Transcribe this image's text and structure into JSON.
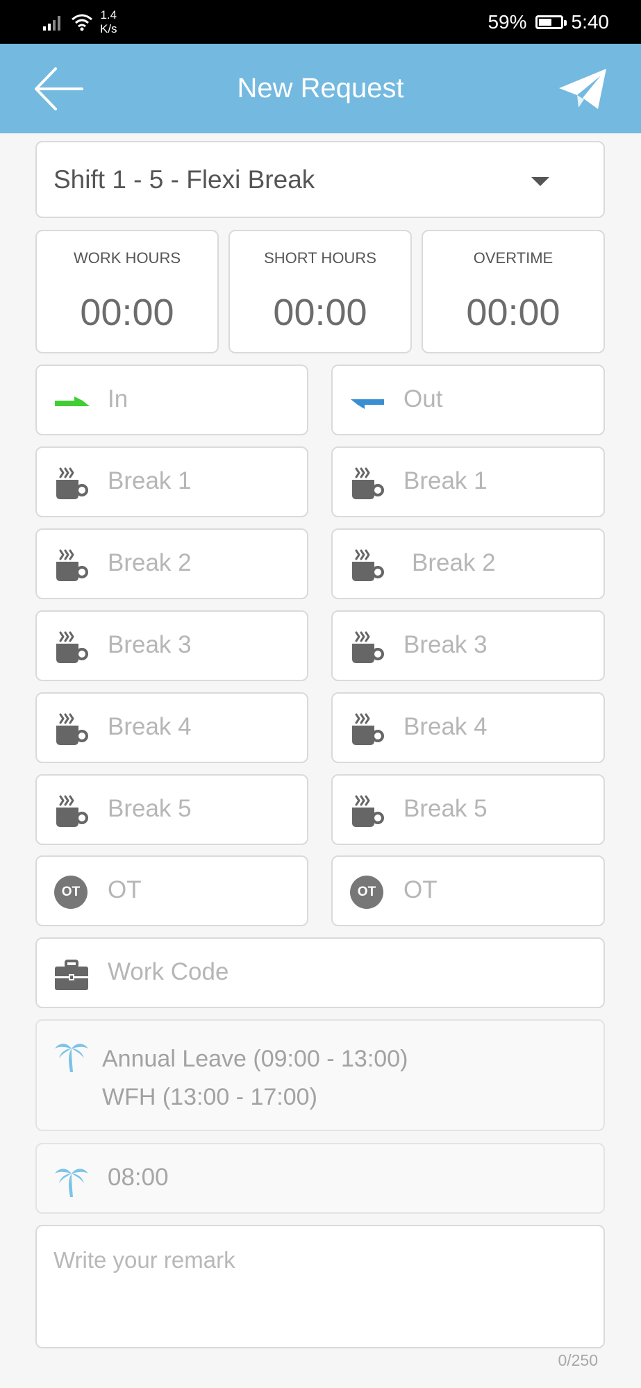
{
  "status_bar": {
    "net_speed": "1.4",
    "net_unit": "K/s",
    "battery_percent": "59%",
    "battery_level": 0.59,
    "time": "5:40",
    "icons": [
      "signal-icon",
      "wifi-icon",
      "battery-icon"
    ]
  },
  "app_bar": {
    "title": "New Request",
    "background": "#74b9df",
    "left_icon": "back-arrow-icon",
    "right_icon": "send-icon"
  },
  "shift_select": {
    "value": "Shift 1 - 5 - Flexi Break",
    "icon": "dropdown-caret-icon"
  },
  "stats": [
    {
      "label": "WORK HOURS",
      "value": "00:00"
    },
    {
      "label": "SHORT HOURS",
      "value": "00:00"
    },
    {
      "label": "OVERTIME",
      "value": "00:00"
    }
  ],
  "time_rows": [
    {
      "left": {
        "placeholder": "In",
        "icon": "clock-in-arrow-icon",
        "icon_color": "#3fcf33"
      },
      "right": {
        "placeholder": "Out",
        "icon": "clock-out-arrow-icon",
        "icon_color": "#3a8fd2"
      }
    },
    {
      "left": {
        "placeholder": "Break 1",
        "icon": "coffee-cup-icon"
      },
      "right": {
        "placeholder": "Break 1",
        "icon": "coffee-cup-icon"
      }
    },
    {
      "left": {
        "placeholder": "Break 2",
        "icon": "coffee-cup-icon"
      },
      "right": {
        "placeholder": "Break 2",
        "icon": "coffee-cup-icon"
      }
    },
    {
      "left": {
        "placeholder": "Break 3",
        "icon": "coffee-cup-icon"
      },
      "right": {
        "placeholder": "Break 3",
        "icon": "coffee-cup-icon"
      }
    },
    {
      "left": {
        "placeholder": "Break 4",
        "icon": "coffee-cup-icon"
      },
      "right": {
        "placeholder": "Break 4",
        "icon": "coffee-cup-icon"
      }
    },
    {
      "left": {
        "placeholder": "Break 5",
        "icon": "coffee-cup-icon"
      },
      "right": {
        "placeholder": "Break 5",
        "icon": "coffee-cup-icon"
      }
    },
    {
      "left": {
        "placeholder": "OT",
        "icon": "ot-badge-icon",
        "badge": "OT"
      },
      "right": {
        "placeholder": "OT",
        "icon": "ot-badge-icon",
        "badge": "OT"
      }
    }
  ],
  "work_code": {
    "placeholder": "Work Code",
    "icon": "briefcase-icon"
  },
  "leave_info": {
    "icon": "palm-tree-icon",
    "line1": "Annual Leave (09:00 - 13:00)",
    "line2": "WFH (13:00 - 17:00)"
  },
  "leave_hours": {
    "icon": "palm-tree-icon",
    "value": "08:00"
  },
  "remark": {
    "placeholder": "Write your remark",
    "counter": "0/250"
  }
}
